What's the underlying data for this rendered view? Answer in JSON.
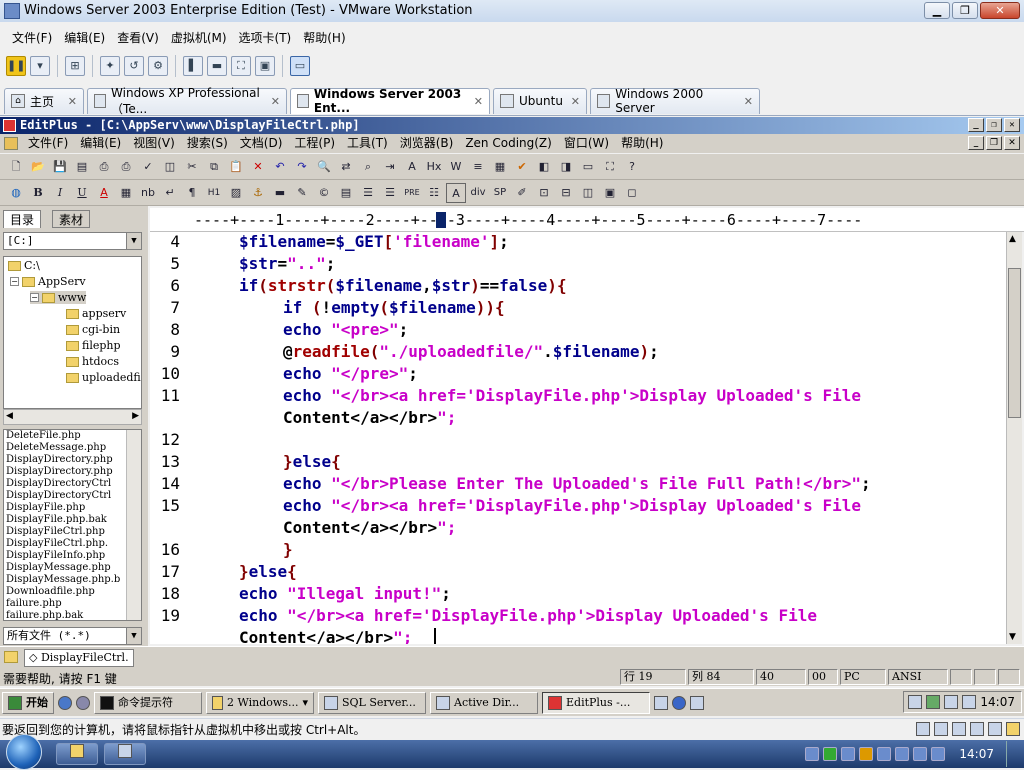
{
  "vmware": {
    "title": "Windows Server 2003 Enterprise Edition (Test) - VMware Workstation",
    "menu": [
      "文件(F)",
      "编辑(E)",
      "查看(V)",
      "虚拟机(M)",
      "选项卡(T)",
      "帮助(H)"
    ],
    "tabs": [
      {
        "label": "主页",
        "close": "✕"
      },
      {
        "label": "Windows XP Professional（Te...",
        "close": "✕"
      },
      {
        "label": "Windows Server 2003 Ent...",
        "close": "✕"
      },
      {
        "label": "Ubuntu",
        "close": "✕"
      },
      {
        "label": "Windows 2000 Server",
        "close": "✕"
      }
    ]
  },
  "editplus": {
    "title": "EditPlus - [C:\\AppServ\\www\\DisplayFileCtrl.php]",
    "menu": [
      "文件(F)",
      "编辑(E)",
      "视图(V)",
      "搜索(S)",
      "文档(D)",
      "工程(P)",
      "工具(T)",
      "浏览器(B)",
      "Zen Coding(Z)",
      "窗口(W)",
      "帮助(H)"
    ],
    "toolbar2_text": [
      "B",
      "I",
      "U",
      "A",
      "nb",
      "↵",
      "¶",
      "H1",
      "PRE",
      "A",
      "div",
      "SP"
    ],
    "side_tabs": [
      "目录",
      "素材"
    ],
    "drive": "[C:]",
    "tree": [
      {
        "label": "C:\\"
      },
      {
        "label": "AppServ",
        "toggle": "−"
      },
      {
        "label": "www",
        "toggle": "−"
      },
      {
        "label": "appserv"
      },
      {
        "label": "cgi-bin"
      },
      {
        "label": "filephp"
      },
      {
        "label": "htdocs"
      },
      {
        "label": "uploadedfi"
      }
    ],
    "files": [
      "DeleteFile.php",
      "DeleteMessage.php",
      "DisplayDirectory.php",
      "DisplayDirectory.php",
      "DisplayDirectoryCtrl",
      "DisplayDirectoryCtrl",
      "DisplayFile.php",
      "DisplayFile.php.bak",
      "DisplayFileCtrl.php",
      "DisplayFileCtrl.php.",
      "DisplayFileInfo.php",
      "DisplayMessage.php",
      "DisplayMessage.php.b",
      "Downloadfile.php",
      "failure.php",
      "failure.php.bak"
    ],
    "filter": "所有文件 (*.*)",
    "ruler": "----+----1----+----2----+----3----+----4----+----5----+----6----+----7----",
    "lines": [
      {
        "n": "4",
        "code": "$filename=$_GET['filename'];"
      },
      {
        "n": "5",
        "code": "$str=\"..\";"
      },
      {
        "n": "6",
        "code": "if(strstr($filename,$str)==false){"
      },
      {
        "n": "7",
        "code": "    if (!empty($filename)){"
      },
      {
        "n": "8",
        "code": "    echo \"<pre>\";"
      },
      {
        "n": "9",
        "code": "    @readfile(\"./uploadedfile/\".$filename);"
      },
      {
        "n": "10",
        "code": "    echo \"</pre>\";"
      },
      {
        "n": "11",
        "code": "    echo \"</br><a href='DisplayFile.php'>Display Uploaded's File"
      },
      {
        "n": "",
        "code": "    Content</a></br>\";"
      },
      {
        "n": "12",
        "code": ""
      },
      {
        "n": "13",
        "code": "    }else{"
      },
      {
        "n": "14",
        "code": "    echo \"</br>Please Enter The Uploaded's File Full Path!</br>\";"
      },
      {
        "n": "15",
        "code": "    echo \"</br><a href='DisplayFile.php'>Display Uploaded's File"
      },
      {
        "n": "",
        "code": "    Content</a></br>\";"
      },
      {
        "n": "16",
        "code": "    }"
      },
      {
        "n": "17",
        "code": "}else{"
      },
      {
        "n": "18",
        "code": "echo \"Illegal input!\";"
      },
      {
        "n": "19",
        "code": "echo \"</br><a href='DisplayFile.php'>Display Uploaded's File"
      },
      {
        "n": "",
        "code": "Content</a></br>\";"
      }
    ],
    "doc_tab": "DisplayFileCtrl.",
    "status": {
      "help": "需要帮助, 请按 F1 键",
      "row": "行 19",
      "col": "列 84",
      "v1": "40",
      "v2": "00",
      "mode": "PC",
      "enc": "ANSI"
    }
  },
  "guest_taskbar": {
    "start": "开始",
    "buttons": [
      "命令提示符",
      "2 Windows...",
      "SQL Server...",
      "Active Dir...",
      "EditPlus -..."
    ],
    "time": "14:07"
  },
  "hint": "要返回到您的计算机，请将鼠标指针从虚拟机中移出或按 Ctrl+Alt。",
  "host_taskbar": {
    "time": "14:07"
  }
}
